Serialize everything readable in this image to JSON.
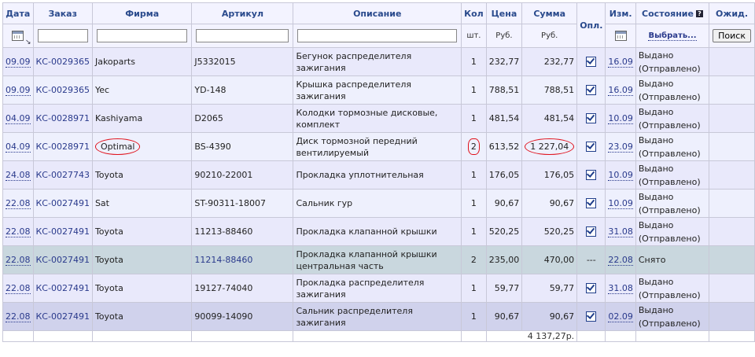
{
  "headers": {
    "date": "Дата",
    "order": "Заказ",
    "firm": "Фирма",
    "article": "Артикул",
    "description": "Описание",
    "qty": "Кол",
    "price": "Цена",
    "sum": "Сумма",
    "paid": "Опл.",
    "changed": "Изм.",
    "status": "Состояние",
    "expected": "Ожид."
  },
  "subheaders": {
    "qty_unit": "шт.",
    "price_unit": "Руб.",
    "sum_unit": "Руб.",
    "choose_label": "Выбрать...",
    "search_button": "Поиск"
  },
  "rows": [
    {
      "date": "09.09",
      "order": "КС-0029365",
      "firm": "Jakoparts",
      "article": "J5332015",
      "description": "Бегунок распределителя зажигания",
      "qty": "1",
      "price": "232,77",
      "sum": "232,77",
      "changed": "16.09",
      "status": "Выдано (Отправлено)"
    },
    {
      "date": "09.09",
      "order": "КС-0029365",
      "firm": "Yec",
      "article": "YD-148",
      "description": "Крышка распределителя зажигания",
      "qty": "1",
      "price": "788,51",
      "sum": "788,51",
      "changed": "16.09",
      "status": "Выдано (Отправлено)"
    },
    {
      "date": "04.09",
      "order": "КС-0028971",
      "firm": "Kashiyama",
      "article": "D2065",
      "description": "Колодки тормозные дисковые, комплект",
      "qty": "1",
      "price": "481,54",
      "sum": "481,54",
      "changed": "10.09",
      "status": "Выдано (Отправлено)"
    },
    {
      "date": "04.09",
      "order": "КС-0028971",
      "firm": "Optimal",
      "article": "BS-4390",
      "description": "Диск тормозной передний вентилируемый",
      "qty": "2",
      "price": "613,52",
      "sum": "1 227,04",
      "changed": "23.09",
      "status": "Выдано (Отправлено)"
    },
    {
      "date": "24.08",
      "order": "КС-0027743",
      "firm": "Toyota",
      "article": "90210-22001",
      "description": "Прокладка уплотнительная",
      "qty": "1",
      "price": "176,05",
      "sum": "176,05",
      "changed": "10.09",
      "status": "Выдано (Отправлено)"
    },
    {
      "date": "22.08",
      "order": "КС-0027491",
      "firm": "Sat",
      "article": "ST-90311-18007",
      "description": "Сальник гур",
      "qty": "1",
      "price": "90,67",
      "sum": "90,67",
      "changed": "10.09",
      "status": "Выдано (Отправлено)"
    },
    {
      "date": "22.08",
      "order": "КС-0027491",
      "firm": "Toyota",
      "article": "11213-88460",
      "description": "Прокладка клапанной крышки",
      "qty": "1",
      "price": "520,25",
      "sum": "520,25",
      "changed": "31.08",
      "status": "Выдано (Отправлено)"
    },
    {
      "date": "22.08",
      "order": "КС-0027491",
      "firm": "Toyota",
      "article": "11214-88460",
      "description": "Прокладка клапанной крышки центральная часть",
      "qty": "2",
      "price": "235,00",
      "sum": "470,00",
      "paid_text": "---",
      "changed": "22.08",
      "status": "Снято"
    },
    {
      "date": "22.08",
      "order": "КС-0027491",
      "firm": "Toyota",
      "article": "19127-74040",
      "description": "Прокладка распределителя зажигания",
      "qty": "1",
      "price": "59,77",
      "sum": "59,77",
      "changed": "31.08",
      "status": "Выдано (Отправлено)"
    },
    {
      "date": "22.08",
      "order": "КС-0027491",
      "firm": "Toyota",
      "article": "90099-14090",
      "description": "Сальник распределителя зажигания",
      "qty": "1",
      "price": "90,67",
      "sum": "90,67",
      "changed": "02.09",
      "status": "Выдано (Отправлено)"
    }
  ],
  "total": "4 137,27р.",
  "colors": {
    "header_text": "#2a4a8c",
    "row_bg": "#e9e9fb",
    "cancelled_bg": "#c9d7de",
    "annotation": "#e0101a"
  }
}
